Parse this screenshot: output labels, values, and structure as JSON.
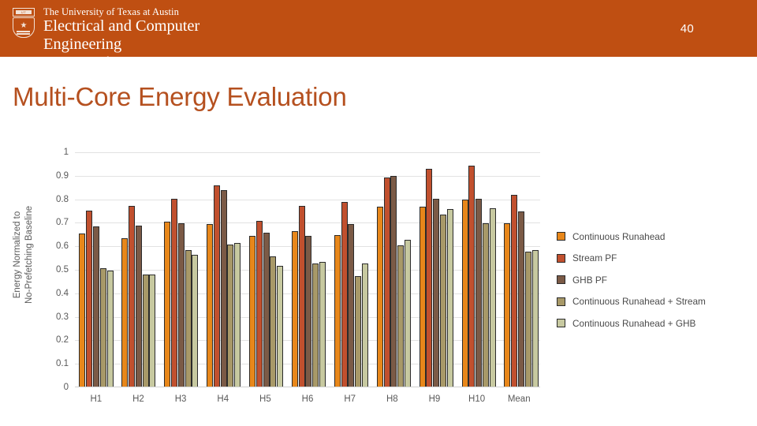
{
  "header": {
    "brand_line1": "The University of Texas at Austin",
    "brand_line2": "Electrical and Computer",
    "brand_line3": "Engineering",
    "brand_line4": "Cockrell School of Engineering",
    "seal_text": "UT",
    "page_number": "40",
    "band_color": "#bf4f12"
  },
  "title": "Multi-Core Energy Evaluation",
  "title_color": "#b5501f",
  "chart_data": {
    "type": "bar",
    "title": "Multi-Core Energy Evaluation",
    "xlabel": "",
    "ylabel": "Energy Normalized to No-Prefetching Baseline",
    "ylabel_line1": "Energy Normalized to",
    "ylabel_line2": "No-Prefetching Baseline",
    "ylim": [
      0,
      1
    ],
    "ytick_labels": [
      "1",
      "0.9",
      "0.8",
      "0.7",
      "0.6",
      "0.5",
      "0.4",
      "0.3",
      "0.2",
      "0.1",
      "0"
    ],
    "ytick_values": [
      1,
      0.9,
      0.8,
      0.7,
      0.6,
      0.5,
      0.4,
      0.3,
      0.2,
      0.1,
      0
    ],
    "grid": true,
    "legend_position": "right",
    "categories": [
      "H1",
      "H2",
      "H3",
      "H4",
      "H5",
      "H6",
      "H7",
      "H8",
      "H9",
      "H10",
      "Mean"
    ],
    "series": [
      {
        "name": "Continuous Runahead",
        "color": "#E8871A",
        "values": [
          0.65,
          0.63,
          0.7,
          0.69,
          0.64,
          0.66,
          0.645,
          0.765,
          0.765,
          0.795,
          0.695
        ]
      },
      {
        "name": "Stream PF",
        "color": "#C1502E",
        "values": [
          0.75,
          0.77,
          0.8,
          0.855,
          0.705,
          0.77,
          0.785,
          0.89,
          0.925,
          0.94,
          0.815
        ]
      },
      {
        "name": "GHB PF",
        "color": "#7B5A46",
        "values": [
          0.68,
          0.685,
          0.695,
          0.835,
          0.655,
          0.64,
          0.69,
          0.895,
          0.8,
          0.8,
          0.745
        ]
      },
      {
        "name": "Continuous Runahead + Stream",
        "color": "#A89968",
        "values": [
          0.505,
          0.475,
          0.58,
          0.605,
          0.555,
          0.525,
          0.47,
          0.6,
          0.73,
          0.695,
          0.575
        ]
      },
      {
        "name": "Continuous Runahead + GHB",
        "color": "#C7C9A0",
        "values": [
          0.495,
          0.475,
          0.56,
          0.61,
          0.515,
          0.53,
          0.525,
          0.625,
          0.755,
          0.76,
          0.58
        ]
      }
    ]
  },
  "legend": {
    "items": [
      {
        "label": "Continuous Runahead",
        "color": "#E8871A"
      },
      {
        "label": "Stream PF",
        "color": "#C1502E"
      },
      {
        "label": "GHB PF",
        "color": "#7B5A46"
      },
      {
        "label": "Continuous Runahead + Stream",
        "color": "#A89968"
      },
      {
        "label": "Continuous Runahead + GHB",
        "color": "#C7C9A0"
      }
    ]
  }
}
